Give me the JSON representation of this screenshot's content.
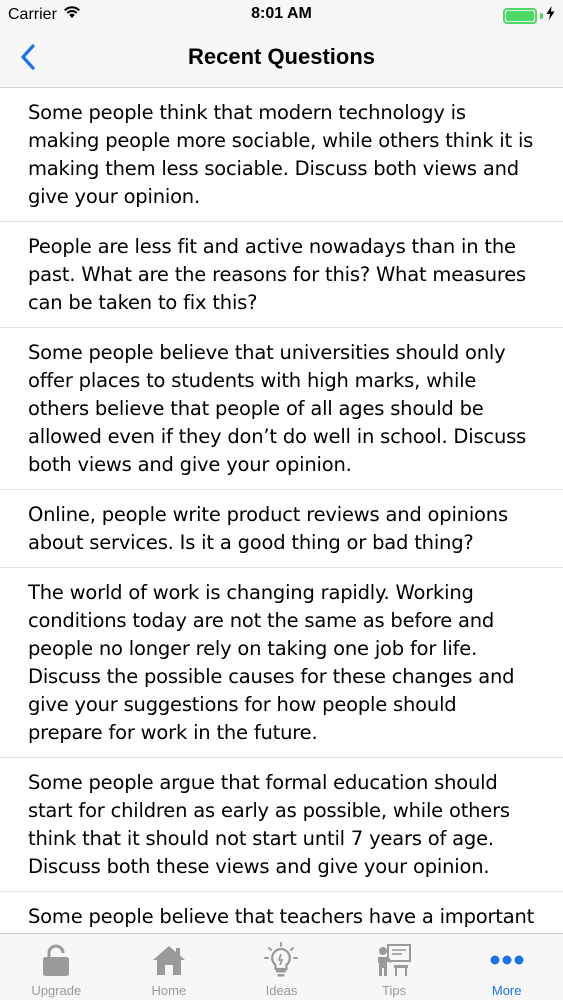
{
  "status_bar": {
    "carrier": "Carrier",
    "time": "8:01 AM",
    "battery_level": 1.0
  },
  "nav": {
    "title": "Recent Questions",
    "back_icon": "chevron-left-icon"
  },
  "questions": [
    "Some people think that modern technology is making people more sociable, while others think it is making them less sociable. Discuss both views and give your opinion.",
    "People are less fit and active nowadays than in the past. What are the reasons for this? What measures can be taken to fix this?",
    "Some people believe that universities should only offer places to students with high marks, while others believe that people of all ages should be allowed even if they don’t do well in school. Discuss both views and give your opinion.",
    "Online, people write product reviews and opinions about services. Is it a good thing or bad thing?",
    "The world of work is changing rapidly. Working conditions today are not the same as before and people no longer rely on taking one job for life. Discuss the possible causes for these changes and give your suggestions for how people should prepare for work in the future.",
    "Some people argue that formal education should start for children as early as possible, while others think that it should not start until 7 years of age. Discuss both these views and give your opinion.",
    "Some people believe that teachers have a important role to play in the educational success"
  ],
  "tabs": [
    {
      "label": "Upgrade",
      "icon": "lock-icon",
      "active": false
    },
    {
      "label": "Home",
      "icon": "home-icon",
      "active": false
    },
    {
      "label": "Ideas",
      "icon": "lightbulb-icon",
      "active": false
    },
    {
      "label": "Tips",
      "icon": "teacher-icon",
      "active": false
    },
    {
      "label": "More",
      "icon": "more-dots-icon",
      "active": true
    }
  ],
  "colors": {
    "accent": "#1a73e8",
    "inactive": "#9a9a9a",
    "battery": "#4cd964"
  }
}
